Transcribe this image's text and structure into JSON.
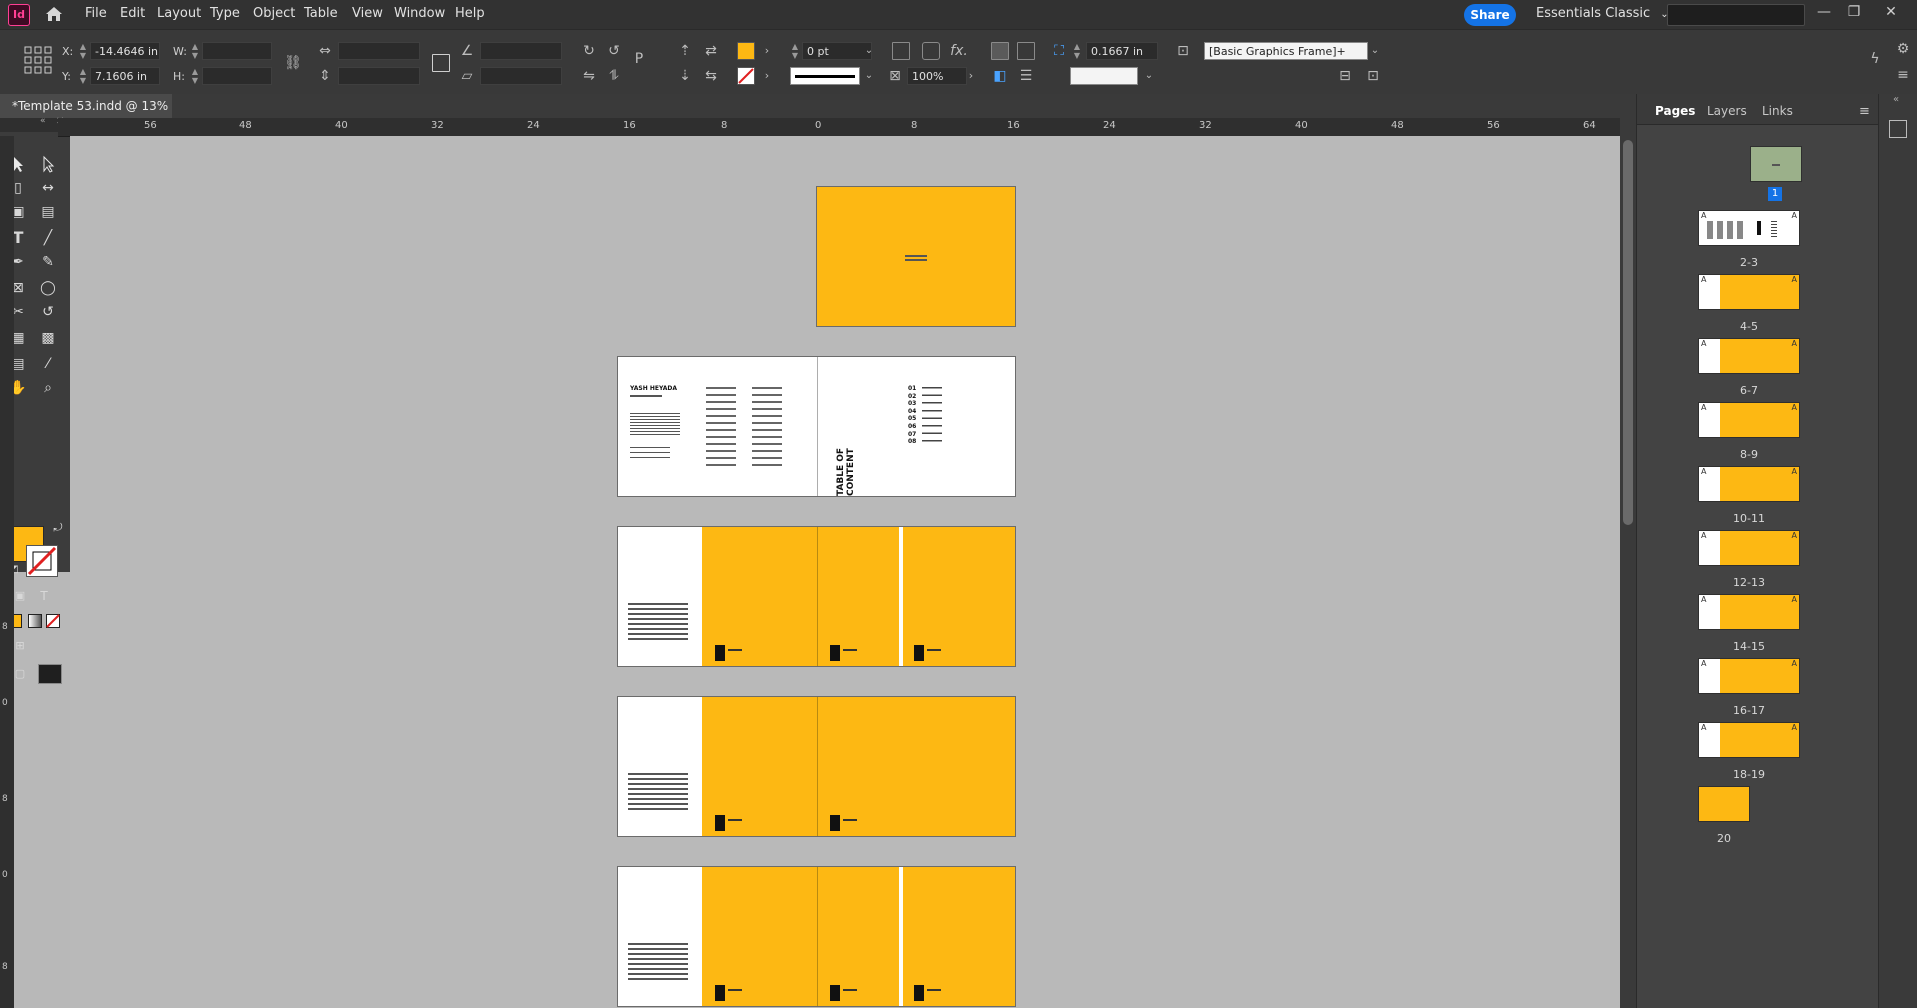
{
  "menubar": {
    "app_logo": "Id",
    "items": [
      "File",
      "Edit",
      "Layout",
      "Type",
      "Object",
      "Table",
      "View",
      "Window",
      "Help"
    ],
    "share_label": "Share",
    "workspace_label": "Essentials Classic",
    "window_controls": [
      "—",
      "❐",
      "✕"
    ]
  },
  "control": {
    "x_label": "X:",
    "x_value": "-14.4646 in",
    "y_label": "Y:",
    "y_value": "7.1606 in",
    "w_label": "W:",
    "h_label": "H:",
    "stroke_weight": "0 pt",
    "scale_percent": "100%",
    "offset_value": "0.1667 in",
    "object_style": "[Basic Graphics Frame]+",
    "fill_color": "#fdb813"
  },
  "document": {
    "tab_label": "*Template 53.indd @ 13%",
    "close_glyph": "✕"
  },
  "ruler": {
    "ticks": [
      "56",
      "48",
      "40",
      "32",
      "24",
      "16",
      "8",
      "0",
      "8",
      "16",
      "24",
      "32",
      "40",
      "48",
      "56",
      "64"
    ],
    "vticks": [
      "8",
      "0",
      "8",
      "0",
      "8"
    ]
  },
  "canvas": {
    "page1_mark": "—",
    "spread2": {
      "name_text": "YASH HEYADA",
      "toc_title": "TABLE OF CONTENT",
      "toc_numbers": [
        "01",
        "02",
        "03",
        "04",
        "05",
        "06",
        "07",
        "08"
      ]
    }
  },
  "pages_panel": {
    "tabs": [
      "Pages",
      "Layers",
      "Links"
    ],
    "selected_page": "1",
    "master_letter": "A",
    "spreads": [
      "2-3",
      "4-5",
      "6-7",
      "8-9",
      "10-11",
      "12-13",
      "14-15",
      "16-17",
      "18-19",
      "20"
    ]
  },
  "colors": {
    "accent_yellow": "#fdb813",
    "share_blue": "#1473e6",
    "app_pink": "#ff3f94"
  }
}
